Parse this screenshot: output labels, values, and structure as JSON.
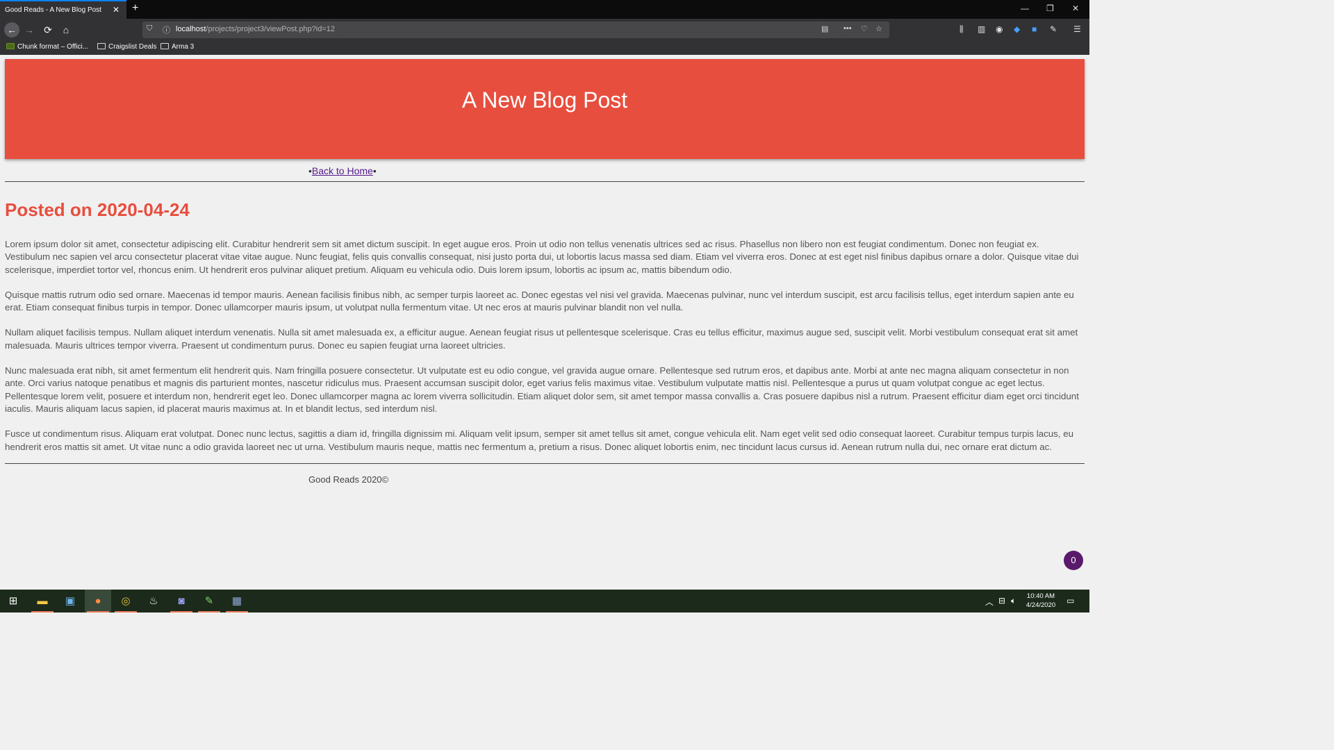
{
  "browser": {
    "tab_title": "Good Reads - A New Blog Post",
    "tab_close": "✕",
    "new_tab": "+",
    "url_host": "localhost",
    "url_path": "/projects/project3/viewPost.php?id=12",
    "bookmarks": [
      {
        "label": "Chunk format – Offici..."
      },
      {
        "label": "Craigslist Deals"
      },
      {
        "label": "Arma 3"
      }
    ],
    "icons": [
      "back-icon",
      "forward-icon",
      "reload-icon",
      "home-icon",
      "shield-icon",
      "info-icon",
      "reader-icon",
      "more-icon",
      "pocket-icon",
      "star-icon",
      "library-icon",
      "sidebar-icon",
      "account-icon",
      "extension-icon",
      "menu-icon"
    ]
  },
  "page": {
    "title": "A New Blog Post",
    "nav_prefix": "•",
    "back_link": "Back to Home",
    "nav_suffix": "•",
    "posted": "Posted on 2020-04-24",
    "paragraphs": [
      "Lorem ipsum dolor sit amet, consectetur adipiscing elit. Curabitur hendrerit sem sit amet dictum suscipit. In eget augue eros. Proin ut odio non tellus venenatis ultrices sed ac risus. Phasellus non libero non est feugiat condimentum. Donec non feugiat ex. Vestibulum nec sapien vel arcu consectetur placerat vitae vitae augue. Nunc feugiat, felis quis convallis consequat, nisi justo porta dui, ut lobortis lacus massa sed diam. Etiam vel viverra eros. Donec at est eget nisl finibus dapibus ornare a dolor. Quisque vitae dui scelerisque, imperdiet tortor vel, rhoncus enim. Ut hendrerit eros pulvinar aliquet pretium. Aliquam eu vehicula odio. Duis lorem ipsum, lobortis ac ipsum ac, mattis bibendum odio.",
      "Quisque mattis rutrum odio sed ornare. Maecenas id tempor mauris. Aenean facilisis finibus nibh, ac semper turpis laoreet ac. Donec egestas vel nisi vel gravida. Maecenas pulvinar, nunc vel interdum suscipit, est arcu facilisis tellus, eget interdum sapien ante eu erat. Etiam consequat finibus turpis in tempor. Donec ullamcorper mauris ipsum, ut volutpat nulla fermentum vitae. Ut nec eros at mauris pulvinar blandit non vel nulla.",
      "Nullam aliquet facilisis tempus. Nullam aliquet interdum venenatis. Nulla sit amet malesuada ex, a efficitur augue. Aenean feugiat risus ut pellentesque scelerisque. Cras eu tellus efficitur, maximus augue sed, suscipit velit. Morbi vestibulum consequat erat sit amet malesuada. Mauris ultrices tempor viverra. Praesent ut condimentum purus. Donec eu sapien feugiat urna laoreet ultricies.",
      "Nunc malesuada erat nibh, sit amet fermentum elit hendrerit quis. Nam fringilla posuere consectetur. Ut vulputate est eu odio congue, vel gravida augue ornare. Pellentesque sed rutrum eros, et dapibus ante. Morbi at ante nec magna aliquam consectetur in non ante. Orci varius natoque penatibus et magnis dis parturient montes, nascetur ridiculus mus. Praesent accumsan suscipit dolor, eget varius felis maximus vitae. Vestibulum vulputate mattis nisl. Pellentesque a purus ut quam volutpat congue ac eget lectus. Pellentesque lorem velit, posuere et interdum non, hendrerit eget leo. Donec ullamcorper magna ac lorem viverra sollicitudin. Etiam aliquet dolor sem, sit amet tempor massa convallis a. Cras posuere dapibus nisl a rutrum. Praesent efficitur diam eget orci tincidunt iaculis. Mauris aliquam lacus sapien, id placerat mauris maximus at. In et blandit lectus, sed interdum nisl.",
      "Fusce ut condimentum risus. Aliquam erat volutpat. Donec nunc lectus, sagittis a diam id, fringilla dignissim mi. Aliquam velit ipsum, semper sit amet tellus sit amet, congue vehicula elit. Nam eget velit sed odio consequat laoreet. Curabitur tempus turpis lacus, eu hendrerit eros mattis sit amet. Ut vitae nunc a odio gravida laoreet nec ut urna. Vestibulum mauris neque, mattis nec fermentum a, pretium a risus. Donec aliquet lobortis enim, nec tincidunt lacus cursus id. Aenean rutrum nulla dui, nec ornare erat dictum ac."
    ],
    "footer": "Good Reads 2020©",
    "badge_count": "0",
    "colors": {
      "accent": "#e84e3e",
      "background": "#f0f0f0"
    }
  },
  "taskbar": {
    "time": "10:40 AM",
    "date": "4/24/2020",
    "apps": [
      "start-icon",
      "file-explorer-icon",
      "control-panel-icon",
      "firefox-icon",
      "chrome-icon",
      "steam-icon",
      "discord-icon",
      "notepad-icon",
      "app-icon"
    ]
  }
}
